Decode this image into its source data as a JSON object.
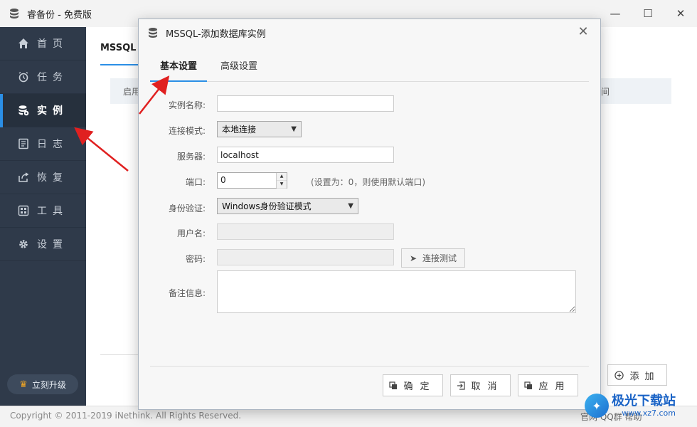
{
  "window": {
    "title": "睿备份 - 免费版",
    "controls": {
      "minimize": "—",
      "maximize": "☐",
      "close": "✕"
    }
  },
  "sidebar": {
    "items": [
      {
        "label": "首页",
        "icon": "home-icon",
        "active": false
      },
      {
        "label": "任务",
        "icon": "alarm-clock-icon",
        "active": false
      },
      {
        "label": "实例",
        "icon": "database-icon",
        "active": true
      },
      {
        "label": "日志",
        "icon": "log-icon",
        "active": false
      },
      {
        "label": "恢复",
        "icon": "restore-icon",
        "active": false
      },
      {
        "label": "工具",
        "icon": "tools-icon",
        "active": false
      },
      {
        "label": "设置",
        "icon": "gear-icon",
        "active": false
      }
    ],
    "upgrade_label": "立刻升级"
  },
  "content": {
    "tab_label": "MSSQL",
    "header_left": "启用",
    "header_right": "间",
    "add_label": "添加"
  },
  "statusbar": {
    "copyright": "Copyright © 2011-2019 iNethink. All Rights Reserved.",
    "links": "官网   QQ群   帮助"
  },
  "dialog": {
    "title": "MSSQL-添加数据库实例",
    "close": "✕",
    "tabs": [
      {
        "label": "基本设置",
        "active": true
      },
      {
        "label": "高级设置",
        "active": false
      }
    ],
    "fields": {
      "instance_name": {
        "label": "实例名称:",
        "value": ""
      },
      "connect_mode": {
        "label": "连接模式:",
        "value": "本地连接"
      },
      "server": {
        "label": "服务器:",
        "value": "localhost"
      },
      "port": {
        "label": "端口:",
        "value": "0",
        "hint": "(设置为：0，则使用默认端口)"
      },
      "auth": {
        "label": "身份验证:",
        "value": "Windows身份验证模式"
      },
      "username": {
        "label": "用户名:",
        "value": ""
      },
      "password": {
        "label": "密码:",
        "value": ""
      },
      "note": {
        "label": "备注信息:",
        "value": ""
      }
    },
    "test_label": "连接测试",
    "buttons": {
      "ok": "确定",
      "cancel": "取消",
      "apply": "应用"
    }
  },
  "watermark": {
    "main": "极光下载站",
    "sub": "www.xz7.com"
  },
  "colors": {
    "accent": "#2b8fe6",
    "sidebar_bg": "#2f3a4a",
    "annotation_arrow": "#e02020"
  }
}
